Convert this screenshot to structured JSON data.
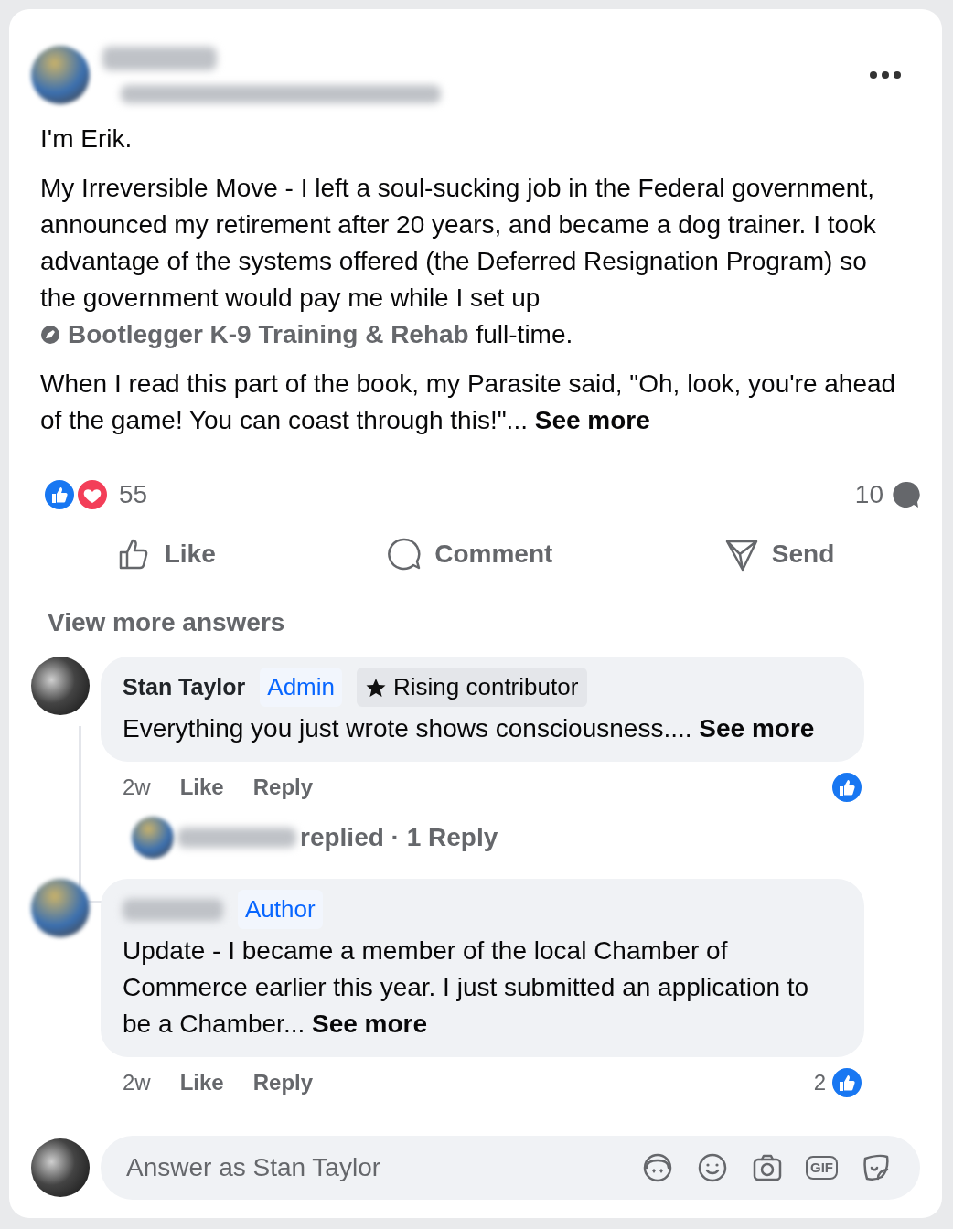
{
  "post": {
    "intro": "I'm Erik.",
    "body": {
      "text": "My Irreversible Move - I left a soul-sucking job in the Federal government, announced my retirement after 20 years, and became a dog trainer. I took advantage of the systems offered (the Deferred Resignation Program) so the government would pay me while I set up",
      "link": "Bootlegger K-9 Training & Rehab",
      "after": " full-time."
    },
    "closing": {
      "text": "When I read this part of the book, my Parasite said, \"Oh, look, you're ahead of the game! You can coast through this!\"...",
      "see_more": "See more"
    },
    "reactions_count": "55",
    "comments_count": "10"
  },
  "actions": [
    {
      "kind": "like",
      "label": "Like"
    },
    {
      "kind": "comment",
      "label": "Comment"
    },
    {
      "kind": "send",
      "label": "Send"
    }
  ],
  "view_more": "View more answers",
  "comments": [
    {
      "author": "Stan Taylor",
      "badges": [
        {
          "kind": "role",
          "text": "Admin"
        },
        {
          "kind": "star",
          "text": "Rising contributor"
        }
      ],
      "text": "Everything you just wrote shows consciousness....",
      "see_more": "See more",
      "time": "2w",
      "like": "Like",
      "reply": "Reply",
      "reply_summary": "replied · 1 Reply"
    },
    {
      "badges": [
        {
          "kind": "role",
          "text": "Author"
        }
      ],
      "text": "Update - I became a member of the local Chamber of Commerce earlier this year. I just submitted an application to be a Chamber...",
      "see_more": "See more",
      "time": "2w",
      "like": "Like",
      "reply": "Reply",
      "like_count": "2"
    }
  ],
  "composer": {
    "placeholder": "Answer as Stan Taylor",
    "gif_label": "GIF"
  }
}
